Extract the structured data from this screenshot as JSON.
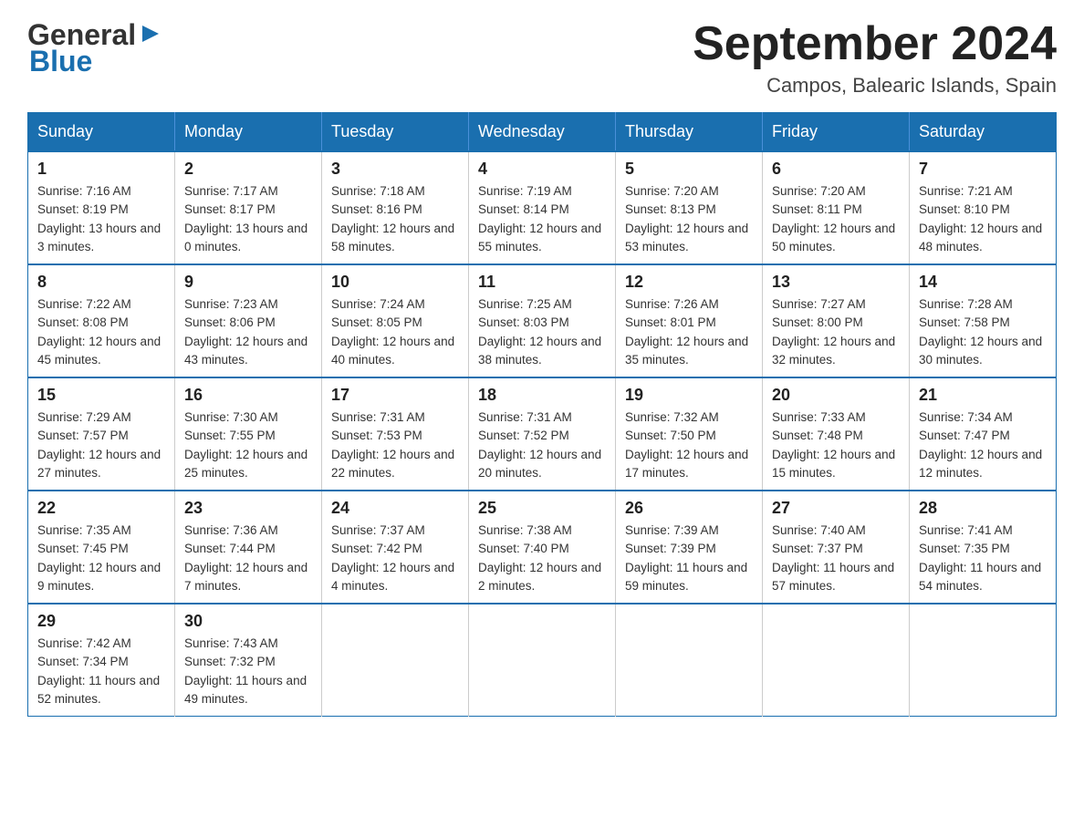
{
  "logo": {
    "general": "General",
    "triangle": "▶",
    "blue": "Blue"
  },
  "title": {
    "month_year": "September 2024",
    "location": "Campos, Balearic Islands, Spain"
  },
  "days_of_week": [
    "Sunday",
    "Monday",
    "Tuesday",
    "Wednesday",
    "Thursday",
    "Friday",
    "Saturday"
  ],
  "weeks": [
    [
      {
        "day": "1",
        "sunrise": "Sunrise: 7:16 AM",
        "sunset": "Sunset: 8:19 PM",
        "daylight": "Daylight: 13 hours and 3 minutes."
      },
      {
        "day": "2",
        "sunrise": "Sunrise: 7:17 AM",
        "sunset": "Sunset: 8:17 PM",
        "daylight": "Daylight: 13 hours and 0 minutes."
      },
      {
        "day": "3",
        "sunrise": "Sunrise: 7:18 AM",
        "sunset": "Sunset: 8:16 PM",
        "daylight": "Daylight: 12 hours and 58 minutes."
      },
      {
        "day": "4",
        "sunrise": "Sunrise: 7:19 AM",
        "sunset": "Sunset: 8:14 PM",
        "daylight": "Daylight: 12 hours and 55 minutes."
      },
      {
        "day": "5",
        "sunrise": "Sunrise: 7:20 AM",
        "sunset": "Sunset: 8:13 PM",
        "daylight": "Daylight: 12 hours and 53 minutes."
      },
      {
        "day": "6",
        "sunrise": "Sunrise: 7:20 AM",
        "sunset": "Sunset: 8:11 PM",
        "daylight": "Daylight: 12 hours and 50 minutes."
      },
      {
        "day": "7",
        "sunrise": "Sunrise: 7:21 AM",
        "sunset": "Sunset: 8:10 PM",
        "daylight": "Daylight: 12 hours and 48 minutes."
      }
    ],
    [
      {
        "day": "8",
        "sunrise": "Sunrise: 7:22 AM",
        "sunset": "Sunset: 8:08 PM",
        "daylight": "Daylight: 12 hours and 45 minutes."
      },
      {
        "day": "9",
        "sunrise": "Sunrise: 7:23 AM",
        "sunset": "Sunset: 8:06 PM",
        "daylight": "Daylight: 12 hours and 43 minutes."
      },
      {
        "day": "10",
        "sunrise": "Sunrise: 7:24 AM",
        "sunset": "Sunset: 8:05 PM",
        "daylight": "Daylight: 12 hours and 40 minutes."
      },
      {
        "day": "11",
        "sunrise": "Sunrise: 7:25 AM",
        "sunset": "Sunset: 8:03 PM",
        "daylight": "Daylight: 12 hours and 38 minutes."
      },
      {
        "day": "12",
        "sunrise": "Sunrise: 7:26 AM",
        "sunset": "Sunset: 8:01 PM",
        "daylight": "Daylight: 12 hours and 35 minutes."
      },
      {
        "day": "13",
        "sunrise": "Sunrise: 7:27 AM",
        "sunset": "Sunset: 8:00 PM",
        "daylight": "Daylight: 12 hours and 32 minutes."
      },
      {
        "day": "14",
        "sunrise": "Sunrise: 7:28 AM",
        "sunset": "Sunset: 7:58 PM",
        "daylight": "Daylight: 12 hours and 30 minutes."
      }
    ],
    [
      {
        "day": "15",
        "sunrise": "Sunrise: 7:29 AM",
        "sunset": "Sunset: 7:57 PM",
        "daylight": "Daylight: 12 hours and 27 minutes."
      },
      {
        "day": "16",
        "sunrise": "Sunrise: 7:30 AM",
        "sunset": "Sunset: 7:55 PM",
        "daylight": "Daylight: 12 hours and 25 minutes."
      },
      {
        "day": "17",
        "sunrise": "Sunrise: 7:31 AM",
        "sunset": "Sunset: 7:53 PM",
        "daylight": "Daylight: 12 hours and 22 minutes."
      },
      {
        "day": "18",
        "sunrise": "Sunrise: 7:31 AM",
        "sunset": "Sunset: 7:52 PM",
        "daylight": "Daylight: 12 hours and 20 minutes."
      },
      {
        "day": "19",
        "sunrise": "Sunrise: 7:32 AM",
        "sunset": "Sunset: 7:50 PM",
        "daylight": "Daylight: 12 hours and 17 minutes."
      },
      {
        "day": "20",
        "sunrise": "Sunrise: 7:33 AM",
        "sunset": "Sunset: 7:48 PM",
        "daylight": "Daylight: 12 hours and 15 minutes."
      },
      {
        "day": "21",
        "sunrise": "Sunrise: 7:34 AM",
        "sunset": "Sunset: 7:47 PM",
        "daylight": "Daylight: 12 hours and 12 minutes."
      }
    ],
    [
      {
        "day": "22",
        "sunrise": "Sunrise: 7:35 AM",
        "sunset": "Sunset: 7:45 PM",
        "daylight": "Daylight: 12 hours and 9 minutes."
      },
      {
        "day": "23",
        "sunrise": "Sunrise: 7:36 AM",
        "sunset": "Sunset: 7:44 PM",
        "daylight": "Daylight: 12 hours and 7 minutes."
      },
      {
        "day": "24",
        "sunrise": "Sunrise: 7:37 AM",
        "sunset": "Sunset: 7:42 PM",
        "daylight": "Daylight: 12 hours and 4 minutes."
      },
      {
        "day": "25",
        "sunrise": "Sunrise: 7:38 AM",
        "sunset": "Sunset: 7:40 PM",
        "daylight": "Daylight: 12 hours and 2 minutes."
      },
      {
        "day": "26",
        "sunrise": "Sunrise: 7:39 AM",
        "sunset": "Sunset: 7:39 PM",
        "daylight": "Daylight: 11 hours and 59 minutes."
      },
      {
        "day": "27",
        "sunrise": "Sunrise: 7:40 AM",
        "sunset": "Sunset: 7:37 PM",
        "daylight": "Daylight: 11 hours and 57 minutes."
      },
      {
        "day": "28",
        "sunrise": "Sunrise: 7:41 AM",
        "sunset": "Sunset: 7:35 PM",
        "daylight": "Daylight: 11 hours and 54 minutes."
      }
    ],
    [
      {
        "day": "29",
        "sunrise": "Sunrise: 7:42 AM",
        "sunset": "Sunset: 7:34 PM",
        "daylight": "Daylight: 11 hours and 52 minutes."
      },
      {
        "day": "30",
        "sunrise": "Sunrise: 7:43 AM",
        "sunset": "Sunset: 7:32 PM",
        "daylight": "Daylight: 11 hours and 49 minutes."
      },
      null,
      null,
      null,
      null,
      null
    ]
  ]
}
